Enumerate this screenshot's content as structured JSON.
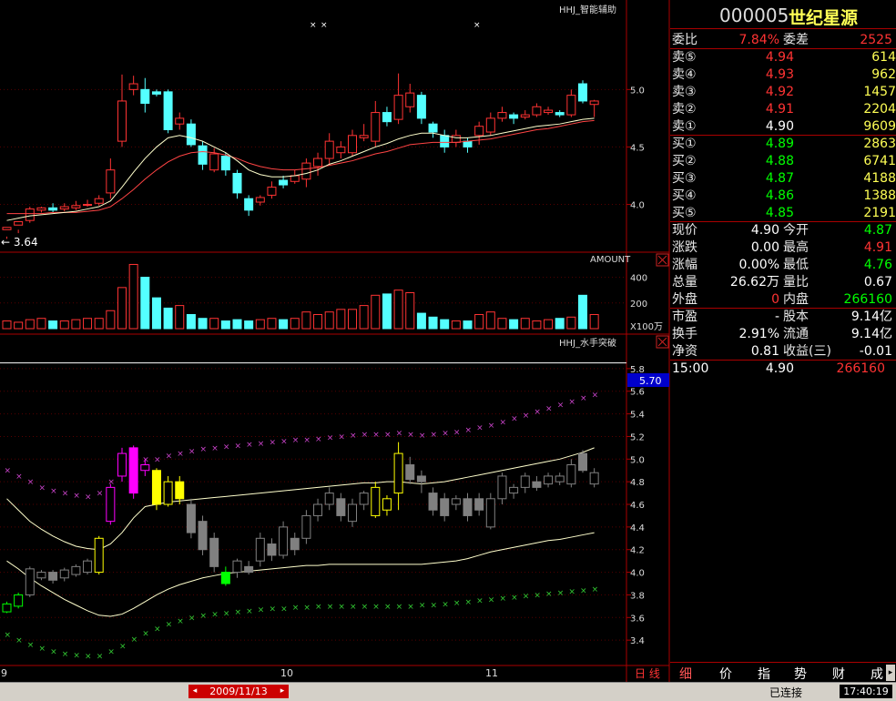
{
  "header": {
    "code": "000005",
    "name": "世纪星源"
  },
  "colors": {
    "up": "#ff3333",
    "down": "#54ffff",
    "white": "#ffffff",
    "yellow": "#ffff00",
    "green": "#00ff00",
    "magenta": "#ff00ff",
    "gray": "#808080",
    "grid": "#550000",
    "bg": "#000000"
  },
  "quote": {
    "weibi_label": "委比",
    "weibi_value": "7.84%",
    "weicha_label": "委差",
    "weicha_value": "2525",
    "sell": [
      {
        "label": "卖⑤",
        "price": "4.94",
        "vol": "614"
      },
      {
        "label": "卖④",
        "price": "4.93",
        "vol": "962"
      },
      {
        "label": "卖③",
        "price": "4.92",
        "vol": "1457"
      },
      {
        "label": "卖②",
        "price": "4.91",
        "vol": "2204"
      },
      {
        "label": "卖①",
        "price": "4.90",
        "vol": "9609"
      }
    ],
    "buy": [
      {
        "label": "买①",
        "price": "4.89",
        "vol": "2863"
      },
      {
        "label": "买②",
        "price": "4.88",
        "vol": "6741"
      },
      {
        "label": "买③",
        "price": "4.87",
        "vol": "4188"
      },
      {
        "label": "买④",
        "price": "4.86",
        "vol": "1388"
      },
      {
        "label": "买⑤",
        "price": "4.85",
        "vol": "2191"
      }
    ],
    "stats1": [
      {
        "l1": "现价",
        "v1": "4.90",
        "l2": "今开",
        "v2": "4.87"
      },
      {
        "l1": "涨跌",
        "v1": "0.00",
        "l2": "最高",
        "v2": "4.91"
      },
      {
        "l1": "涨幅",
        "v1": "0.00%",
        "l2": "最低",
        "v2": "4.76"
      },
      {
        "l1": "总量",
        "v1": "26.62万",
        "l2": "量比",
        "v2": "0.67"
      },
      {
        "l1": "外盘",
        "v1": "0",
        "l2": "内盘",
        "v2": "266160"
      }
    ],
    "stats2": [
      {
        "l1": "市盈",
        "v1": "-",
        "l2": "股本",
        "v2": "9.14亿"
      },
      {
        "l1": "换手",
        "v1": "2.91%",
        "l2": "流通",
        "v2": "9.14亿"
      },
      {
        "l1": "净资",
        "v1": "0.81",
        "l2": "收益(三)",
        "v2": "-0.01"
      }
    ],
    "tick": {
      "time": "15:00",
      "price": "4.90",
      "vol": "266160"
    }
  },
  "tabs": [
    "细",
    "价",
    "指",
    "势",
    "财",
    "成"
  ],
  "chart_labels": {
    "main_indicator": "HHJ_智能辅助",
    "vol_indicator": "AMOUNT",
    "vol_unit": "X100万",
    "sub_indicator": "HHJ_水手突破",
    "low_marker": "← 3.64",
    "current_value_box": "5.70",
    "x_labels": [
      "9",
      "10",
      "11"
    ],
    "date_label": "2009/11/13",
    "period_label": "日 线",
    "status_conn": "已连接",
    "status_time": "17:40:19"
  },
  "chart_data": [
    {
      "type": "candlestick",
      "title": "HHJ_智能辅助",
      "yticks": [
        4.0,
        4.5,
        5.0
      ],
      "ylim": [
        3.6,
        5.7
      ],
      "candles": [
        [
          3.78,
          3.8,
          3.72,
          3.7
        ],
        [
          3.82,
          3.85,
          3.78,
          3.75
        ],
        [
          3.86,
          3.96,
          3.98,
          3.84
        ],
        [
          3.95,
          3.97,
          3.98,
          3.93
        ],
        [
          3.97,
          3.95,
          4.01,
          3.93
        ],
        [
          3.96,
          3.98,
          4.01,
          3.94
        ],
        [
          3.97,
          3.99,
          4.03,
          3.95
        ],
        [
          4.0,
          4.0,
          4.04,
          3.98
        ],
        [
          4.01,
          4.05,
          4.08,
          3.99
        ],
        [
          4.1,
          4.3,
          4.4,
          4.05
        ],
        [
          4.55,
          4.9,
          5.13,
          4.5
        ],
        [
          5.0,
          5.05,
          5.12,
          4.95
        ],
        [
          5.0,
          4.88,
          5.1,
          4.8
        ],
        [
          4.98,
          4.96,
          5.0,
          4.94
        ],
        [
          4.98,
          4.65,
          5.0,
          4.62
        ],
        [
          4.7,
          4.75,
          4.8,
          4.65
        ],
        [
          4.7,
          4.52,
          4.74,
          4.5
        ],
        [
          4.51,
          4.35,
          4.55,
          4.3
        ],
        [
          4.3,
          4.44,
          4.49,
          4.28
        ],
        [
          4.42,
          4.3,
          4.45,
          4.25
        ],
        [
          4.27,
          4.1,
          4.3,
          4.05
        ],
        [
          4.05,
          3.95,
          4.08,
          3.9
        ],
        [
          4.02,
          4.06,
          4.08,
          3.99
        ],
        [
          4.08,
          4.15,
          4.2,
          4.05
        ],
        [
          4.21,
          4.17,
          4.25,
          4.14
        ],
        [
          4.2,
          4.25,
          4.3,
          4.18
        ],
        [
          4.22,
          4.36,
          4.4,
          4.15
        ],
        [
          4.33,
          4.4,
          4.45,
          4.25
        ],
        [
          4.4,
          4.55,
          4.62,
          4.35
        ],
        [
          4.45,
          4.5,
          4.55,
          4.4
        ],
        [
          4.45,
          4.6,
          4.65,
          4.42
        ],
        [
          4.58,
          4.6,
          4.7,
          4.55
        ],
        [
          4.55,
          4.8,
          4.9,
          4.5
        ],
        [
          4.8,
          4.72,
          4.85,
          4.68
        ],
        [
          4.74,
          4.95,
          5.14,
          4.7
        ],
        [
          4.85,
          4.97,
          5.05,
          4.8
        ],
        [
          4.95,
          4.75,
          4.98,
          4.7
        ],
        [
          4.7,
          4.63,
          4.72,
          4.58
        ],
        [
          4.6,
          4.5,
          4.65,
          4.45
        ],
        [
          4.54,
          4.6,
          4.65,
          4.5
        ],
        [
          4.55,
          4.5,
          4.58,
          4.45
        ],
        [
          4.6,
          4.68,
          4.72,
          4.52
        ],
        [
          4.63,
          4.75,
          4.8,
          4.6
        ],
        [
          4.75,
          4.8,
          4.85,
          4.72
        ],
        [
          4.78,
          4.75,
          4.8,
          4.7
        ],
        [
          4.76,
          4.78,
          4.82,
          4.74
        ],
        [
          4.78,
          4.85,
          4.88,
          4.76
        ],
        [
          4.8,
          4.82,
          4.85,
          4.78
        ],
        [
          4.8,
          4.78,
          4.82,
          4.76
        ],
        [
          4.78,
          4.95,
          5.0,
          4.76
        ],
        [
          5.05,
          4.9,
          5.08,
          4.88
        ],
        [
          4.87,
          4.9,
          4.91,
          4.76
        ]
      ],
      "ma_short": [
        3.86,
        3.88,
        3.9,
        3.91,
        3.92,
        3.93,
        3.94,
        3.96,
        3.98,
        4.03,
        4.15,
        4.28,
        4.4,
        4.5,
        4.58,
        4.6,
        4.58,
        4.55,
        4.5,
        4.45,
        4.38,
        4.3,
        4.26,
        4.24,
        4.24,
        4.25,
        4.27,
        4.3,
        4.35,
        4.38,
        4.42,
        4.46,
        4.5,
        4.53,
        4.57,
        4.6,
        4.62,
        4.62,
        4.6,
        4.58,
        4.58,
        4.59,
        4.6,
        4.62,
        4.64,
        4.66,
        4.68,
        4.69,
        4.7,
        4.72,
        4.74,
        4.75
      ],
      "ma_long": [
        3.92,
        3.92,
        3.92,
        3.92,
        3.93,
        3.93,
        3.93,
        3.94,
        3.95,
        3.98,
        4.05,
        4.13,
        4.22,
        4.3,
        4.37,
        4.42,
        4.45,
        4.46,
        4.45,
        4.43,
        4.4,
        4.36,
        4.33,
        4.31,
        4.3,
        4.3,
        4.31,
        4.32,
        4.34,
        4.36,
        4.38,
        4.41,
        4.44,
        4.46,
        4.49,
        4.52,
        4.53,
        4.54,
        4.54,
        4.54,
        4.55,
        4.56,
        4.57,
        4.59,
        4.61,
        4.63,
        4.65,
        4.66,
        4.68,
        4.7,
        4.72,
        4.73
      ]
    },
    {
      "type": "bar",
      "title": "AMOUNT",
      "yticks": [
        200,
        400
      ],
      "ylim": [
        0,
        560
      ],
      "values": [
        60,
        50,
        70,
        80,
        60,
        60,
        70,
        80,
        80,
        140,
        320,
        500,
        400,
        240,
        160,
        180,
        110,
        80,
        80,
        60,
        70,
        60,
        70,
        80,
        70,
        80,
        130,
        110,
        130,
        150,
        150,
        180,
        260,
        270,
        300,
        280,
        120,
        90,
        70,
        60,
        60,
        110,
        130,
        80,
        70,
        80,
        60,
        70,
        80,
        90,
        260,
        110
      ]
    },
    {
      "type": "candlestick",
      "title": "HHJ_水手突破",
      "yticks": [
        3.4,
        3.6,
        3.8,
        4.0,
        4.2,
        4.4,
        4.6,
        4.8,
        5.0,
        5.2,
        5.4,
        5.6,
        5.8
      ],
      "ylim": [
        3.2,
        5.96
      ],
      "reference_line": 5.85,
      "candles": [
        [
          3.65,
          3.72,
          3.74,
          3.64
        ],
        [
          3.7,
          3.8,
          3.82,
          3.68
        ],
        [
          3.8,
          4.03,
          4.05,
          3.78
        ],
        [
          3.95,
          4.0,
          4.02,
          3.93
        ],
        [
          4.0,
          3.93,
          4.02,
          3.9
        ],
        [
          3.95,
          4.02,
          4.04,
          3.92
        ],
        [
          3.98,
          4.05,
          4.07,
          3.96
        ],
        [
          4.0,
          4.1,
          4.12,
          3.98
        ],
        [
          4.0,
          4.3,
          4.32,
          3.98
        ],
        [
          4.45,
          4.75,
          4.78,
          4.42
        ],
        [
          4.85,
          5.05,
          5.1,
          4.8
        ],
        [
          5.1,
          4.7,
          5.12,
          4.65
        ],
        [
          4.9,
          4.95,
          5.0,
          4.85
        ],
        [
          4.9,
          4.6,
          4.92,
          4.55
        ],
        [
          4.6,
          4.8,
          4.85,
          4.58
        ],
        [
          4.8,
          4.65,
          4.85,
          4.6
        ],
        [
          4.6,
          4.35,
          4.65,
          4.3
        ],
        [
          4.45,
          4.2,
          4.5,
          4.15
        ],
        [
          4.3,
          4.05,
          4.35,
          4.0
        ],
        [
          4.0,
          3.9,
          4.05,
          3.88
        ],
        [
          4.0,
          4.1,
          4.12,
          3.95
        ],
        [
          4.05,
          4.0,
          4.1,
          3.98
        ],
        [
          4.1,
          4.3,
          4.35,
          4.05
        ],
        [
          4.25,
          4.15,
          4.3,
          4.1
        ],
        [
          4.15,
          4.4,
          4.45,
          4.12
        ],
        [
          4.3,
          4.2,
          4.35,
          4.15
        ],
        [
          4.3,
          4.5,
          4.55,
          4.25
        ],
        [
          4.5,
          4.6,
          4.65,
          4.45
        ],
        [
          4.6,
          4.7,
          4.75,
          4.55
        ],
        [
          4.65,
          4.5,
          4.7,
          4.45
        ],
        [
          4.45,
          4.6,
          4.65,
          4.4
        ],
        [
          4.6,
          4.7,
          4.72,
          4.55
        ],
        [
          4.5,
          4.75,
          4.8,
          4.48
        ],
        [
          4.55,
          4.65,
          4.68,
          4.5
        ],
        [
          4.7,
          5.05,
          5.15,
          4.55
        ],
        [
          4.95,
          4.82,
          5.02,
          4.78
        ],
        [
          4.85,
          4.8,
          4.9,
          4.7
        ],
        [
          4.7,
          4.55,
          4.75,
          4.5
        ],
        [
          4.65,
          4.5,
          4.7,
          4.45
        ],
        [
          4.6,
          4.65,
          4.68,
          4.55
        ],
        [
          4.65,
          4.5,
          4.7,
          4.45
        ],
        [
          4.65,
          4.55,
          4.7,
          4.5
        ],
        [
          4.4,
          4.65,
          4.7,
          4.38
        ],
        [
          4.65,
          4.85,
          4.88,
          4.6
        ],
        [
          4.7,
          4.75,
          4.78,
          4.65
        ],
        [
          4.75,
          4.85,
          4.88,
          4.7
        ],
        [
          4.8,
          4.75,
          4.85,
          4.72
        ],
        [
          4.78,
          4.85,
          4.88,
          4.75
        ],
        [
          4.8,
          4.85,
          4.88,
          4.77
        ],
        [
          4.78,
          4.95,
          5.0,
          4.75
        ],
        [
          5.05,
          4.9,
          5.08,
          4.88
        ],
        [
          4.78,
          4.88,
          4.92,
          4.75
        ]
      ],
      "candle_colors": [
        "green",
        "green",
        "gray",
        "gray",
        "gray",
        "gray",
        "gray",
        "gray",
        "yellow",
        "magenta",
        "magenta",
        "magenta",
        "magenta",
        "yellow",
        "yellow",
        "yellow",
        "gray",
        "gray",
        "gray",
        "green",
        "gray",
        "gray",
        "gray",
        "gray",
        "gray",
        "gray",
        "gray",
        "gray",
        "gray",
        "gray",
        "gray",
        "gray",
        "yellow",
        "yellow",
        "yellow",
        "gray",
        "gray",
        "gray",
        "gray",
        "gray",
        "gray",
        "gray",
        "gray",
        "gray",
        "gray",
        "gray",
        "gray",
        "gray",
        "gray",
        "gray",
        "gray",
        "gray"
      ],
      "upper_band": [
        4.65,
        4.55,
        4.45,
        4.38,
        4.32,
        4.27,
        4.23,
        4.21,
        4.2,
        4.25,
        4.35,
        4.48,
        4.58,
        4.6,
        4.62,
        4.63,
        4.64,
        4.65,
        4.66,
        4.67,
        4.68,
        4.69,
        4.7,
        4.71,
        4.72,
        4.73,
        4.74,
        4.75,
        4.76,
        4.77,
        4.78,
        4.79,
        4.79,
        4.8,
        4.8,
        4.79,
        4.78,
        4.79,
        4.8,
        4.82,
        4.84,
        4.86,
        4.88,
        4.9,
        4.92,
        4.94,
        4.96,
        4.98,
        5.0,
        5.03,
        5.06,
        5.1
      ],
      "lower_band": [
        4.1,
        4.03,
        3.95,
        3.88,
        3.82,
        3.76,
        3.71,
        3.66,
        3.62,
        3.61,
        3.63,
        3.68,
        3.74,
        3.8,
        3.85,
        3.89,
        3.92,
        3.95,
        3.97,
        3.99,
        4.0,
        4.01,
        4.02,
        4.03,
        4.04,
        4.05,
        4.06,
        4.06,
        4.07,
        4.07,
        4.07,
        4.07,
        4.07,
        4.07,
        4.07,
        4.07,
        4.07,
        4.08,
        4.09,
        4.1,
        4.12,
        4.15,
        4.18,
        4.2,
        4.22,
        4.24,
        4.26,
        4.28,
        4.29,
        4.31,
        4.33,
        4.35
      ],
      "upper_cross": [
        4.9,
        4.85,
        4.8,
        4.75,
        4.72,
        4.7,
        4.68,
        4.67,
        4.7,
        4.8,
        4.88,
        4.95,
        5.0,
        5.0,
        5.03,
        5.05,
        5.07,
        5.09,
        5.1,
        5.11,
        5.12,
        5.13,
        5.14,
        5.15,
        5.16,
        5.17,
        5.17,
        5.18,
        5.19,
        5.2,
        5.21,
        5.22,
        5.22,
        5.22,
        5.23,
        5.22,
        5.21,
        5.22,
        5.23,
        5.24,
        5.26,
        5.28,
        5.3,
        5.33,
        5.36,
        5.39,
        5.42,
        5.45,
        5.48,
        5.51,
        5.54,
        5.57
      ],
      "lower_cross": [
        3.45,
        3.4,
        3.36,
        3.33,
        3.3,
        3.28,
        3.27,
        3.26,
        3.26,
        3.3,
        3.35,
        3.41,
        3.46,
        3.5,
        3.54,
        3.57,
        3.6,
        3.62,
        3.63,
        3.64,
        3.65,
        3.66,
        3.67,
        3.68,
        3.68,
        3.69,
        3.69,
        3.7,
        3.7,
        3.7,
        3.7,
        3.7,
        3.7,
        3.7,
        3.7,
        3.7,
        3.71,
        3.71,
        3.72,
        3.73,
        3.74,
        3.75,
        3.76,
        3.77,
        3.78,
        3.79,
        3.8,
        3.81,
        3.82,
        3.83,
        3.84,
        3.85
      ]
    }
  ]
}
